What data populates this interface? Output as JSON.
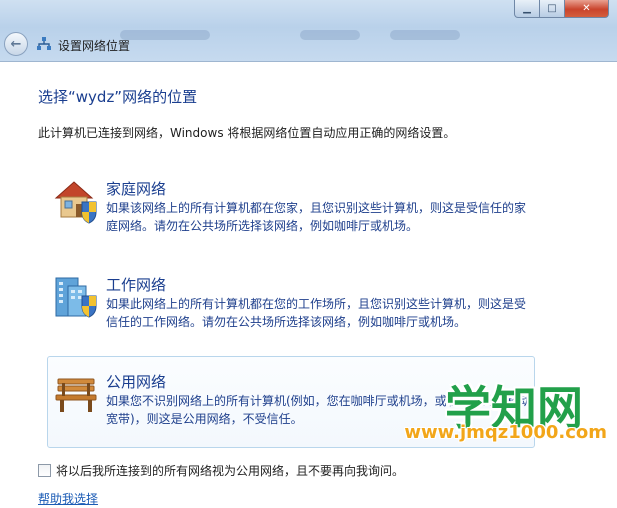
{
  "window": {
    "title": "设置网络位置",
    "back_symbol": "←",
    "caption": {
      "min": "▁",
      "max": "□",
      "close": "✕"
    }
  },
  "heading": "选择“wydz”网络的位置",
  "intro": "此计算机已连接到网络，Windows 将根据网络位置自动应用正确的网络设置。",
  "options": [
    {
      "title": "家庭网络",
      "desc": "如果该网络上的所有计算机都在您家，且您识别这些计算机，则这是受信任的家庭网络。请勿在公共场所选择该网络，例如咖啡厅或机场。",
      "icon": "home-network-icon"
    },
    {
      "title": "工作网络",
      "desc": "如果此网络上的所有计算机都在您的工作场所，且您识别这些计算机，则这是受信任的工作网络。请勿在公共场所选择该网络，例如咖啡厅或机场。",
      "icon": "work-network-icon"
    },
    {
      "title": "公用网络",
      "desc": "如果您不识别网络上的所有计算机(例如，您在咖啡厅或机场，或者使用的是移动宽带)，则这是公用网络，不受信任。",
      "icon": "public-network-icon"
    }
  ],
  "checkbox": {
    "label": "将以后我所连接到的所有网络视为公用网络，且不要再向我询问。",
    "checked": false
  },
  "help_link": "帮助我选择",
  "watermark": {
    "main": "学知网",
    "sub": "www.jmqz1000.com"
  },
  "colors": {
    "link": "#1a3e8f",
    "accent_green": "#22a04a",
    "accent_orange": "#f2a619"
  }
}
